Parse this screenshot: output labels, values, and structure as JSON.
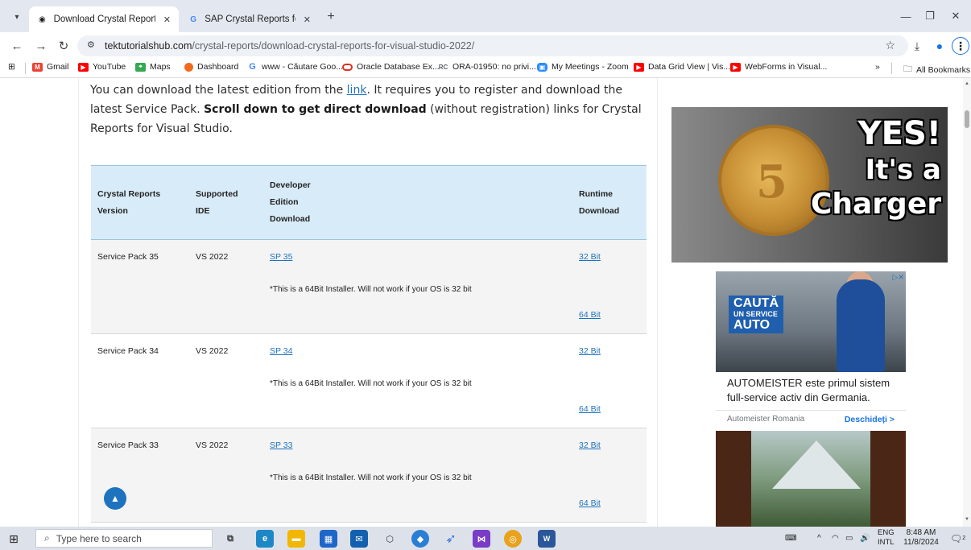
{
  "browser": {
    "tabs": [
      {
        "title": "Download Crystal Reports for V",
        "active": true
      },
      {
        "title": "SAP Crystal Reports for Visual S",
        "active": false
      }
    ],
    "url_host": "tektutorialshub.com",
    "url_path": "/crystal-reports/download-crystal-reports-for-visual-studio-2022/",
    "bookmarks": [
      {
        "label": "Gmail",
        "icon": "gmail-icon",
        "color": "#ea4335"
      },
      {
        "label": "YouTube",
        "icon": "youtube-icon",
        "color": "#ff0000"
      },
      {
        "label": "Maps",
        "icon": "maps-icon",
        "color": "#34a853"
      },
      {
        "label": "Dashboard",
        "icon": "dashboard-icon",
        "color": "#f26b1d"
      },
      {
        "label": "www - Căutare Goo...",
        "icon": "google-icon",
        "color": "#4285f4"
      },
      {
        "label": "Oracle Database Ex...",
        "icon": "oracle-icon",
        "color": "#e0301e"
      },
      {
        "label": "ORA-01950: no privi...",
        "icon": "ora-icon",
        "color": "#5f6368"
      },
      {
        "label": "My Meetings - Zoom",
        "icon": "zoom-icon",
        "color": "#2d8cff"
      },
      {
        "label": "Data Grid View | Vis...",
        "icon": "youtube-icon",
        "color": "#ff0000"
      },
      {
        "label": "WebForms in Visual...",
        "icon": "youtube-icon",
        "color": "#ff0000"
      }
    ],
    "more_bookmarks": "»",
    "all_bookmarks": "All Bookmarks"
  },
  "article": {
    "intro_1": "You can download the latest edition from the ",
    "intro_link": "link",
    "intro_2": ". It requires you to register and download the latest Service Pack. ",
    "intro_bold": "Scroll down to get direct download",
    "intro_3": " (without registration) links for Crystal Reports for Visual Studio.",
    "table": {
      "headers": {
        "version": [
          "Crystal Reports",
          "Version"
        ],
        "ide": [
          "Supported",
          "IDE"
        ],
        "developer": [
          "Developer",
          "Edition",
          "Download"
        ],
        "runtime": [
          "Runtime",
          "Download"
        ]
      },
      "rows": [
        {
          "version": "Service Pack 35",
          "ide": "VS 2022",
          "sp": "SP 35",
          "note": "*This is a 64Bit Installer. Will not work if your OS is 32 bit",
          "bit32": "32 Bit",
          "bit64": "64 Bit"
        },
        {
          "version": "Service Pack 34",
          "ide": "VS 2022",
          "sp": "SP 34",
          "note": "*This is a 64Bit Installer. Will not work if your OS is 32 bit",
          "bit32": "32 Bit",
          "bit64": "64 Bit"
        },
        {
          "version": "Service Pack 33",
          "ide": "VS 2022",
          "sp": "SP 33",
          "note": "*This is a 64Bit Installer. Will not work if your OS is 32 bit",
          "bit32": "32 Bit",
          "bit64": "64 Bit"
        }
      ]
    }
  },
  "ads": {
    "ad1": {
      "line1": "YES!",
      "line2": "It's a",
      "line3": "Charger",
      "coin": "5"
    },
    "ad2": {
      "badge_1": "CAUTĂ",
      "badge_2": "UN SERVICE",
      "badge_3": "AUTO",
      "headline": "AUTOMEISTER este primul sistem full-service activ din Germania.",
      "advertiser": "Automeister Romania",
      "cta": "Deschideți  >"
    }
  },
  "taskbar": {
    "search_placeholder": "Type here to search",
    "lang_1": "ENG",
    "lang_2": "INTL",
    "time": "8:48 AM",
    "date": "11/8/2024",
    "notifications": "2"
  }
}
